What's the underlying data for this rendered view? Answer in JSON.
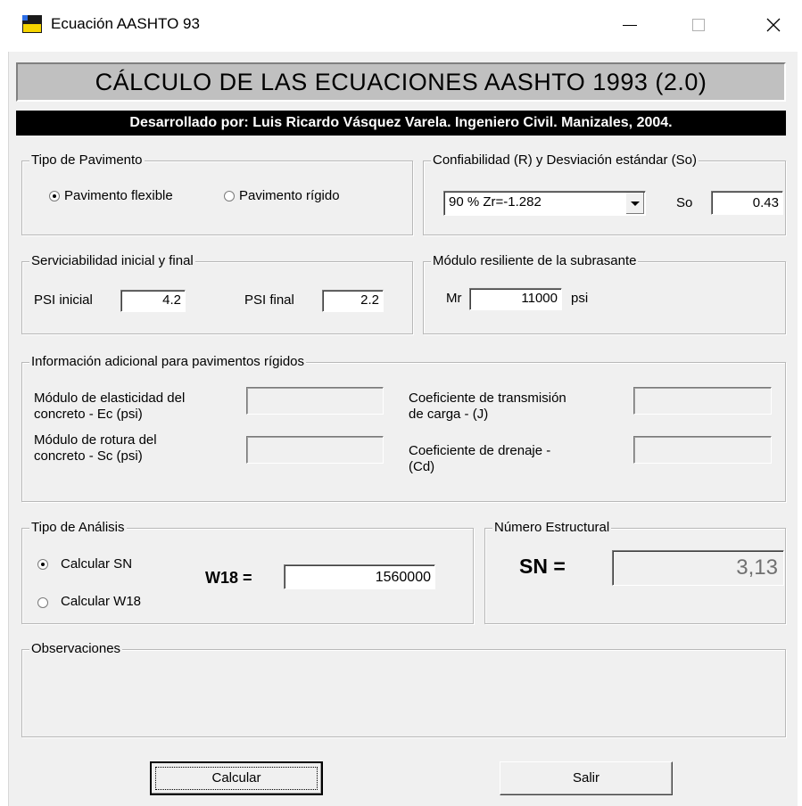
{
  "window": {
    "title": "Ecuación AASHTO 93"
  },
  "header": {
    "banner": "CÁLCULO DE LAS ECUACIONES AASHTO 1993 (2.0)",
    "credit": "Desarrollado por: Luis Ricardo Vásquez Varela.  Ingeniero Civil. Manizales, 2004."
  },
  "pavement_type": {
    "title": "Tipo de Pavimento",
    "flexible": "Pavimento flexible",
    "rigid": "Pavimento rígido",
    "selected": "flexible"
  },
  "reliability": {
    "title": "Confiabilidad (R) y Desviación estándar (So)",
    "selected_option": "90 %  Zr=-1.282",
    "so_label": "So",
    "so_value": "0.43"
  },
  "serviceability": {
    "title": "Serviciabilidad inicial y final",
    "initial_label": "PSI inicial",
    "initial_value": "4.2",
    "final_label": "PSI final",
    "final_value": "2.2"
  },
  "resilient_modulus": {
    "title": "Módulo resiliente de la subrasante",
    "mr_label": "Mr",
    "mr_value": "11000",
    "unit": "psi"
  },
  "rigid_info": {
    "title": "Información adicional para pavimentos rígidos",
    "ec_label_1": "Módulo de elasticidad del",
    "ec_label_2": "concreto - Ec (psi)",
    "sc_label_1": "Módulo de rotura del",
    "sc_label_2": "concreto - Sc (psi)",
    "j_label_1": "Coeficiente de transmisión",
    "j_label_2": "de carga - (J)",
    "cd_label_1": "Coeficiente de drenaje -",
    "cd_label_2": "(Cd)"
  },
  "analysis": {
    "title": "Tipo de Análisis",
    "calc_sn": "Calcular SN",
    "calc_w18": "Calcular W18",
    "selected": "sn",
    "w18_label": "W18 =",
    "w18_value": "1560000"
  },
  "structural_number": {
    "title": "Número Estructural",
    "sn_label": "SN =",
    "sn_value": "3,13"
  },
  "observations": {
    "title": "Observaciones"
  },
  "buttons": {
    "calculate": "Calcular",
    "exit": "Salir"
  },
  "icons": {
    "app": "app-icon",
    "minimize": "minimize-icon",
    "maximize": "maximize-icon",
    "close": "close-icon",
    "dropdown": "chevron-down-icon"
  }
}
